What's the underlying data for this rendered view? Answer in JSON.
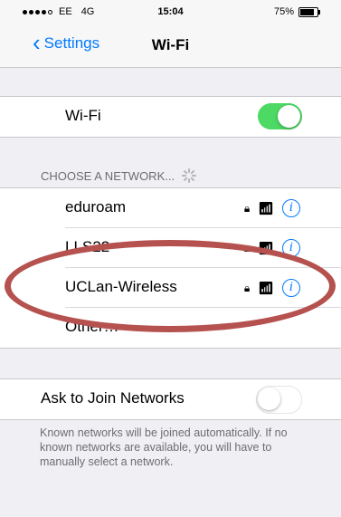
{
  "status_bar": {
    "carrier": "EE",
    "network": "4G",
    "time": "15:04",
    "battery": "75%"
  },
  "nav": {
    "back_label": "Settings",
    "title": "Wi-Fi"
  },
  "wifi_row": {
    "label": "Wi-Fi",
    "enabled": true
  },
  "section_header": "CHOOSE A NETWORK...",
  "networks": [
    {
      "name": "eduroam"
    },
    {
      "name": "LLS22"
    },
    {
      "name": "UCLan-Wireless"
    }
  ],
  "other_label": "Other…",
  "ask_row": {
    "label": "Ask to Join Networks",
    "enabled": false
  },
  "footer_text": "Known networks will be joined automatically. If no known networks are available, you will have to manually select a network.",
  "colors": {
    "accent": "#007aff",
    "toggle_on": "#4cd964",
    "annotation": "#b5514e"
  },
  "icons": {
    "lock": "lock-icon",
    "wifi": "wifi-signal-icon",
    "info": "info-icon"
  }
}
